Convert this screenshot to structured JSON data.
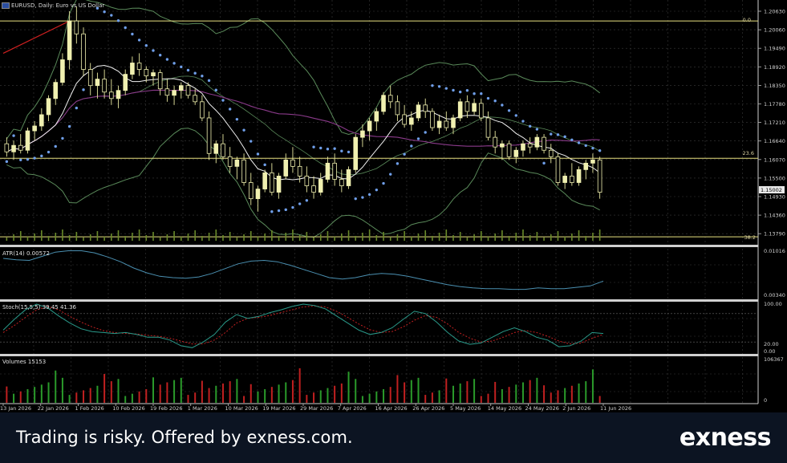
{
  "header": {
    "title": "EURUSD, Daily: Euro vs US Dollar"
  },
  "price_axis": {
    "labels": [
      "1.20630",
      "1.20060",
      "1.19490",
      "1.18920",
      "1.18350",
      "1.17780",
      "1.17210",
      "1.16640",
      "1.16070",
      "1.15500",
      "1.14930",
      "1.14360",
      "1.13790"
    ],
    "current_price": "1.15002"
  },
  "fibonacci": {
    "top": "0.0",
    "mid": "23.6",
    "bottom": "38.2"
  },
  "atr": {
    "label": "ATR(14) 0.00572",
    "axis": [
      "0.01016",
      "0.00340"
    ]
  },
  "stoch": {
    "label": "Stoch(15,5,5) 39.45 41.36",
    "axis": [
      "100.00",
      "20.00",
      "0.00"
    ]
  },
  "volumes": {
    "label": "Volumes 15153",
    "axis": [
      "106367",
      "0"
    ]
  },
  "dates": [
    "13 Jan 2026",
    "22 Jan 2026",
    "1 Feb 2026",
    "10 Feb 2026",
    "19 Feb 2026",
    "1 Mar 2026",
    "10 Mar 2026",
    "19 Mar 2026",
    "29 Mar 2026",
    "7 Apr 2026",
    "16 Apr 2026",
    "26 Apr 2026",
    "5 May 2026",
    "14 May 2026",
    "24 May 2026",
    "2 Jun 2026",
    "11 Jun 2026"
  ],
  "footer": {
    "disclaimer": "Trading is risky. Offered by exness.com.",
    "brand": "exness"
  },
  "colors": {
    "bull": "#f0f0b0",
    "bear": "#f0f0b0",
    "fib": "#e8e080",
    "sar": "#6f9ee8",
    "ma_fast": "#f0f0f0",
    "bands": "#5a8a5a",
    "ma_slow": "#8a3a8a",
    "trend": "#d02020",
    "atr": "#4a8fb0",
    "stoch_main": "#2a9a8a",
    "stoch_signal": "#c02020",
    "vol_up": "#2a9a2a",
    "vol_down": "#c02020",
    "grid": "#2a2a2a",
    "footer_bg": "#0c1422"
  },
  "chart_data": {
    "type": "candlestick",
    "symbol": "EURUSD",
    "timeframe": "Daily",
    "ylim": [
      1.135,
      1.2075
    ],
    "ohlc": [
      [
        1.165,
        1.167,
        1.161,
        1.1625
      ],
      [
        1.1625,
        1.166,
        1.16,
        1.1645
      ],
      [
        1.1645,
        1.168,
        1.162,
        1.163
      ],
      [
        1.163,
        1.17,
        1.162,
        1.169
      ],
      [
        1.169,
        1.172,
        1.166,
        1.1705
      ],
      [
        1.1705,
        1.176,
        1.169,
        1.174
      ],
      [
        1.174,
        1.18,
        1.172,
        1.179
      ],
      [
        1.179,
        1.185,
        1.177,
        1.184
      ],
      [
        1.184,
        1.193,
        1.183,
        1.191
      ],
      [
        1.191,
        1.206,
        1.188,
        1.203
      ],
      [
        1.203,
        1.2075,
        1.196,
        1.199
      ],
      [
        1.199,
        1.201,
        1.186,
        1.188
      ],
      [
        1.188,
        1.19,
        1.18,
        1.183
      ],
      [
        1.183,
        1.187,
        1.179,
        1.185
      ],
      [
        1.185,
        1.188,
        1.179,
        1.181
      ],
      [
        1.181,
        1.185,
        1.177,
        1.179
      ],
      [
        1.179,
        1.183,
        1.176,
        1.1815
      ],
      [
        1.1815,
        1.188,
        1.18,
        1.1865
      ],
      [
        1.1865,
        1.192,
        1.185,
        1.19
      ],
      [
        1.19,
        1.193,
        1.186,
        1.188
      ],
      [
        1.188,
        1.189,
        1.184,
        1.186
      ],
      [
        1.186,
        1.188,
        1.183,
        1.187
      ],
      [
        1.187,
        1.188,
        1.18,
        1.182
      ],
      [
        1.182,
        1.185,
        1.178,
        1.18
      ],
      [
        1.18,
        1.183,
        1.177,
        1.1815
      ],
      [
        1.1815,
        1.184,
        1.179,
        1.183
      ],
      [
        1.183,
        1.184,
        1.179,
        1.18
      ],
      [
        1.18,
        1.182,
        1.177,
        1.178
      ],
      [
        1.178,
        1.18,
        1.172,
        1.173
      ],
      [
        1.173,
        1.175,
        1.16,
        1.162
      ],
      [
        1.162,
        1.166,
        1.159,
        1.165
      ],
      [
        1.165,
        1.168,
        1.16,
        1.161
      ],
      [
        1.161,
        1.164,
        1.156,
        1.158
      ],
      [
        1.158,
        1.161,
        1.154,
        1.16
      ],
      [
        1.16,
        1.162,
        1.152,
        1.153
      ],
      [
        1.153,
        1.156,
        1.146,
        1.148
      ],
      [
        1.148,
        1.152,
        1.144,
        1.151
      ],
      [
        1.151,
        1.157,
        1.15,
        1.156
      ],
      [
        1.156,
        1.159,
        1.149,
        1.15
      ],
      [
        1.15,
        1.156,
        1.148,
        1.155
      ],
      [
        1.155,
        1.162,
        1.154,
        1.16
      ],
      [
        1.16,
        1.164,
        1.156,
        1.158
      ],
      [
        1.158,
        1.161,
        1.153,
        1.155
      ],
      [
        1.155,
        1.158,
        1.15,
        1.152
      ],
      [
        1.152,
        1.155,
        1.148,
        1.15
      ],
      [
        1.15,
        1.156,
        1.149,
        1.154
      ],
      [
        1.154,
        1.161,
        1.153,
        1.159
      ],
      [
        1.159,
        1.162,
        1.152,
        1.154
      ],
      [
        1.154,
        1.157,
        1.15,
        1.152
      ],
      [
        1.152,
        1.158,
        1.151,
        1.157
      ],
      [
        1.157,
        1.168,
        1.156,
        1.167
      ],
      [
        1.167,
        1.171,
        1.164,
        1.169
      ],
      [
        1.169,
        1.173,
        1.166,
        1.172
      ],
      [
        1.172,
        1.176,
        1.169,
        1.175
      ],
      [
        1.175,
        1.181,
        1.174,
        1.18
      ],
      [
        1.18,
        1.183,
        1.176,
        1.178
      ],
      [
        1.178,
        1.18,
        1.172,
        1.174
      ],
      [
        1.174,
        1.177,
        1.17,
        1.171
      ],
      [
        1.171,
        1.175,
        1.169,
        1.173
      ],
      [
        1.173,
        1.178,
        1.172,
        1.177
      ],
      [
        1.177,
        1.179,
        1.173,
        1.175
      ],
      [
        1.175,
        1.176,
        1.169,
        1.17
      ],
      [
        1.17,
        1.174,
        1.168,
        1.172
      ],
      [
        1.172,
        1.175,
        1.169,
        1.17
      ],
      [
        1.17,
        1.174,
        1.168,
        1.173
      ],
      [
        1.173,
        1.179,
        1.172,
        1.178
      ],
      [
        1.178,
        1.18,
        1.173,
        1.175
      ],
      [
        1.175,
        1.179,
        1.174,
        1.1775
      ],
      [
        1.1775,
        1.179,
        1.172,
        1.173
      ],
      [
        1.173,
        1.175,
        1.166,
        1.167
      ],
      [
        1.167,
        1.169,
        1.162,
        1.164
      ],
      [
        1.164,
        1.166,
        1.16,
        1.165
      ],
      [
        1.165,
        1.166,
        1.16,
        1.161
      ],
      [
        1.161,
        1.164,
        1.159,
        1.163
      ],
      [
        1.163,
        1.166,
        1.161,
        1.165
      ],
      [
        1.165,
        1.167,
        1.162,
        1.164
      ],
      [
        1.164,
        1.168,
        1.163,
        1.167
      ],
      [
        1.167,
        1.168,
        1.162,
        1.163
      ],
      [
        1.163,
        1.165,
        1.159,
        1.161
      ],
      [
        1.161,
        1.162,
        1.152,
        1.153
      ],
      [
        1.153,
        1.156,
        1.151,
        1.155
      ],
      [
        1.155,
        1.159,
        1.152,
        1.153
      ],
      [
        1.153,
        1.158,
        1.152,
        1.157
      ],
      [
        1.157,
        1.16,
        1.154,
        1.159
      ],
      [
        1.159,
        1.162,
        1.156,
        1.16
      ],
      [
        1.16,
        1.161,
        1.148,
        1.15
      ]
    ],
    "fib_levels": {
      "0.0": 1.203,
      "23.6": 1.1605,
      "38.2": 1.1362
    },
    "atr": [
      0.009,
      0.0088,
      0.0087,
      0.0093,
      0.0099,
      0.0101,
      0.0101,
      0.0098,
      0.0092,
      0.0085,
      0.0076,
      0.0069,
      0.0064,
      0.0062,
      0.0061,
      0.0063,
      0.0068,
      0.0075,
      0.0082,
      0.0086,
      0.0087,
      0.0085,
      0.008,
      0.0074,
      0.0068,
      0.0062,
      0.006,
      0.0062,
      0.0066,
      0.0068,
      0.0067,
      0.0064,
      0.006,
      0.0056,
      0.0052,
      0.0049,
      0.0047,
      0.0046,
      0.0046,
      0.0045,
      0.0045,
      0.0047,
      0.0046,
      0.0046,
      0.0048,
      0.005,
      0.0057
    ],
    "stoch_main": [
      45,
      68,
      88,
      100,
      92,
      75,
      60,
      48,
      42,
      40,
      38,
      40,
      36,
      30,
      30,
      24,
      12,
      8,
      20,
      36,
      62,
      78,
      70,
      74,
      82,
      88,
      95,
      100,
      97,
      90,
      75,
      60,
      45,
      36,
      40,
      50,
      68,
      85,
      80,
      62,
      40,
      22,
      15,
      18,
      30,
      42,
      50,
      42,
      30,
      24,
      10,
      12,
      22,
      40,
      38
    ],
    "stoch_signal": [
      40,
      55,
      72,
      88,
      95,
      88,
      74,
      62,
      52,
      44,
      40,
      38,
      37,
      34,
      32,
      28,
      22,
      16,
      16,
      24,
      40,
      60,
      70,
      72,
      76,
      82,
      88,
      94,
      96,
      94,
      85,
      72,
      58,
      46,
      40,
      42,
      52,
      66,
      76,
      72,
      58,
      40,
      28,
      20,
      22,
      30,
      40,
      44,
      40,
      32,
      22,
      16,
      18,
      28,
      36
    ]
  }
}
